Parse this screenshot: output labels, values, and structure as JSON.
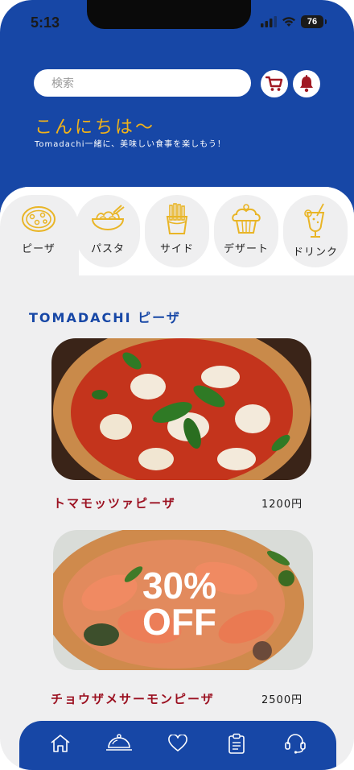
{
  "status_bar": {
    "time": "5:13",
    "battery": "76"
  },
  "header": {
    "search_placeholder": "検索",
    "greeting": "こんにちは〜",
    "subtitle": "Tomadachi一緒に、美味しい食事を楽しもう！",
    "icons": [
      "cart-icon",
      "bell-icon"
    ]
  },
  "categories": [
    {
      "label": "ピーザ",
      "icon": "pizza-icon",
      "active": true
    },
    {
      "label": "パスタ",
      "icon": "pasta-icon",
      "active": false
    },
    {
      "label": "サイド",
      "icon": "fries-icon",
      "active": false
    },
    {
      "label": "デザート",
      "icon": "cupcake-icon",
      "active": false
    },
    {
      "label": "ドリンク",
      "icon": "drink-icon",
      "active": false
    }
  ],
  "section": {
    "title": "TOMADACHI ピーザ"
  },
  "items": [
    {
      "name": "トマモッツァピーザ",
      "price": "1200円",
      "image": "margherita-pizza-image",
      "badge": ""
    },
    {
      "name": "チョウザメサーモンピーザ",
      "price": "2500円",
      "image": "salmon-pizza-image",
      "badge_line1": "30%",
      "badge_line2": "OFF"
    }
  ],
  "bottom_nav": [
    "home-icon",
    "cloche-icon",
    "heart-icon",
    "clipboard-icon",
    "support-icon"
  ],
  "colors": {
    "primary": "#1747a6",
    "accent": "#f1b21a",
    "price_red": "#9b1020",
    "bg": "#efeff0"
  }
}
